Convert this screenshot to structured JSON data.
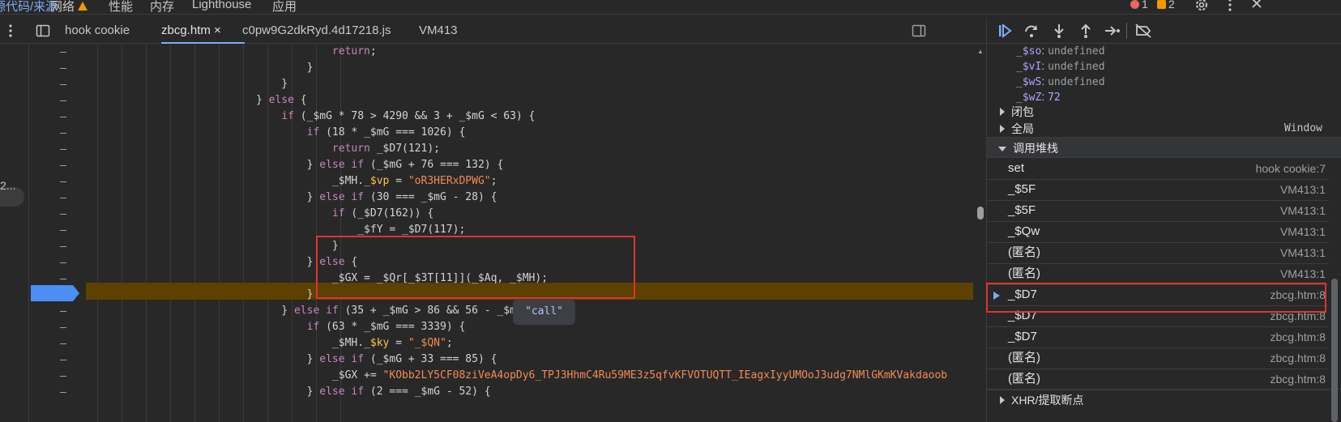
{
  "top_tabs": [
    {
      "label": "源代码/来源",
      "active": true
    },
    {
      "label": "网络",
      "warning": true
    },
    {
      "label": "性能"
    },
    {
      "label": "内存"
    },
    {
      "label": "Lighthouse"
    },
    {
      "label": "应用"
    }
  ],
  "status": {
    "errors": "1",
    "issues": "2"
  },
  "file_tabs": [
    {
      "label": "hook cookie"
    },
    {
      "label": "zbcg.htm ×",
      "active": true
    },
    {
      "label": "c0pw9G2dkRyd.4d17218.js"
    },
    {
      "label": "VM413"
    }
  ],
  "left_truncated": "2...",
  "code_lines": [
    [
      {
        "t": "            "
      },
      {
        "t": "return",
        "c": "kw"
      },
      {
        "t": ";"
      }
    ],
    [
      {
        "t": "        }"
      }
    ],
    [
      {
        "t": "    }"
      }
    ],
    [
      {
        "t": "} "
      },
      {
        "t": "else",
        "c": "kw"
      },
      {
        "t": " {"
      }
    ],
    [
      {
        "t": "    "
      },
      {
        "t": "if",
        "c": "kw"
      },
      {
        "t": " (_$mG * 78 > 4290 && 3 + _$mG < 63) {"
      }
    ],
    [
      {
        "t": "        "
      },
      {
        "t": "if",
        "c": "kw"
      },
      {
        "t": " (18 * _$mG === 1026) {"
      }
    ],
    [
      {
        "t": "            "
      },
      {
        "t": "return",
        "c": "kw"
      },
      {
        "t": " _$D7(121);"
      }
    ],
    [
      {
        "t": "        } "
      },
      {
        "t": "else if",
        "c": "kw"
      },
      {
        "t": " (_$mG + 76 === 132) {"
      }
    ],
    [
      {
        "t": "            _$MH."
      },
      {
        "t": "_$vp",
        "c": "prop"
      },
      {
        "t": " = "
      },
      {
        "t": "\"oR3HERxDPWG\"",
        "c": "str"
      },
      {
        "t": ";"
      }
    ],
    [
      {
        "t": "        } "
      },
      {
        "t": "else if",
        "c": "kw"
      },
      {
        "t": " (30 === _$mG - 28) {"
      }
    ],
    [
      {
        "t": "            "
      },
      {
        "t": "if",
        "c": "kw"
      },
      {
        "t": " (_$D7(162)) {"
      }
    ],
    [
      {
        "t": "                _$fY = _$D7(117);"
      }
    ],
    [
      {
        "t": "            }"
      }
    ],
    [
      {
        "t": "        } "
      },
      {
        "t": "else",
        "c": "kw"
      },
      {
        "t": " {"
      }
    ],
    [
      {
        "t": "            _$GX = _$Qr[_$3T[11]]"
      },
      {
        "t": "(_$Aq, _$MH);"
      }
    ],
    [
      {
        "t": "        }"
      }
    ],
    [
      {
        "t": "    } "
      },
      {
        "t": "else if",
        "c": "kw"
      },
      {
        "t": " (35 + _$mG > 86 && 56 - _$mG > 0) {"
      }
    ],
    [
      {
        "t": "        "
      },
      {
        "t": "if",
        "c": "kw"
      },
      {
        "t": " (63 * _$mG === 3339) {"
      }
    ],
    [
      {
        "t": "            _$MH."
      },
      {
        "t": "_$ky",
        "c": "prop"
      },
      {
        "t": " = "
      },
      {
        "t": "\"_$QN\"",
        "c": "str"
      },
      {
        "t": ";"
      }
    ],
    [
      {
        "t": "        } "
      },
      {
        "t": "else if",
        "c": "kw"
      },
      {
        "t": " (_$mG + 33 === 85) {"
      }
    ],
    [
      {
        "t": "            _$GX += "
      },
      {
        "t": "\"KObb2LY5CF08ziVeA4opDy6_TPJ3HhmC4Ru59ME3z5qfvKFVOTUQTT_IEagxIyyUMOoJ3udg7NMlGKmKVakdaoob",
        "c": "str"
      }
    ],
    [
      {
        "t": "        } "
      },
      {
        "t": "else if",
        "c": "kw"
      },
      {
        "t": " (2 === _$mG - 52) {"
      }
    ]
  ],
  "tooltip": "\"call\"",
  "scope_vars": [
    {
      "key": "_$so",
      "value": "undefined"
    },
    {
      "key": "_$vI",
      "value": "undefined"
    },
    {
      "key": "_$wS",
      "value": "undefined"
    },
    {
      "key": "_$wZ",
      "value": "72",
      "num": true
    }
  ],
  "closure_label": "闭包",
  "global_label": "全局",
  "global_value": "Window",
  "callstack_label": "调用堆栈",
  "call_stack": [
    {
      "name": "set",
      "loc": "hook cookie:7"
    },
    {
      "name": "_$5F",
      "loc": "VM413:1"
    },
    {
      "name": "_$5F",
      "loc": "VM413:1"
    },
    {
      "name": "_$Qw",
      "loc": "VM413:1"
    },
    {
      "name": "(匿名)",
      "loc": "VM413:1"
    },
    {
      "name": "(匿名)",
      "loc": "VM413:1"
    },
    {
      "name": "_$D7",
      "loc": "zbcg.htm:8",
      "current": true
    },
    {
      "name": "_$D7",
      "loc": "zbcg.htm:8"
    },
    {
      "name": "_$D7",
      "loc": "zbcg.htm:8"
    },
    {
      "name": "(匿名)",
      "loc": "zbcg.htm:8"
    },
    {
      "name": "(匿名)",
      "loc": "zbcg.htm:8"
    }
  ],
  "xhr_label": "XHR/提取断点",
  "colors": {
    "accent": "#7cacf8",
    "highlight": "#5c4100",
    "breakpoint": "#4c8df6",
    "annotation": "#e0342b"
  },
  "icons": {
    "debugger": [
      "resume-icon",
      "step-over-icon",
      "step-into-icon",
      "step-out-icon",
      "step-icon",
      "deactivate-breakpoints-icon"
    ],
    "top_right": [
      "settings-gear-icon",
      "more-vert-icon"
    ]
  }
}
